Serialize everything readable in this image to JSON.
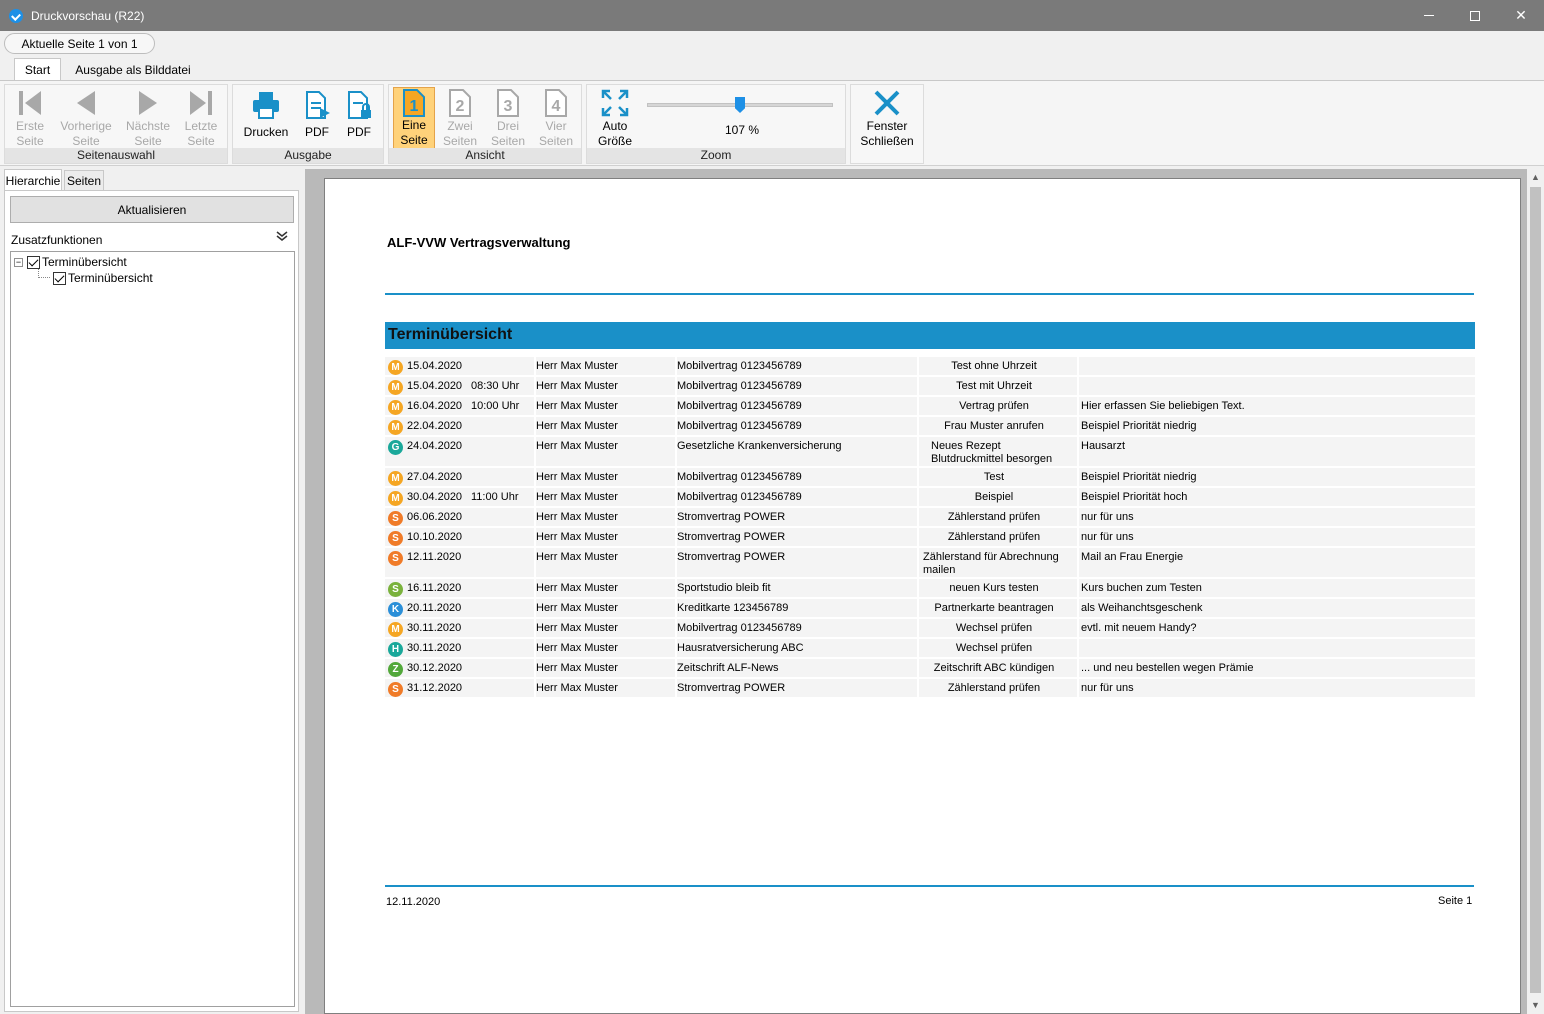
{
  "window": {
    "title": "Druckvorschau (R22)"
  },
  "pagebar": {
    "current_page": "Aktuelle Seite 1 von 1"
  },
  "ribbon_tabs": [
    "Start",
    "Ausgabe als Bilddatei"
  ],
  "ribbon": {
    "seitenauswahl": {
      "label": "Seitenauswahl",
      "first": [
        "Erste",
        "Seite"
      ],
      "prev": [
        "Vorherige",
        "Seite"
      ],
      "next": [
        "Nächste",
        "Seite"
      ],
      "last": [
        "Letzte",
        "Seite"
      ]
    },
    "ausgabe": {
      "label": "Ausgabe",
      "print": "Drucken",
      "pdf1": "PDF",
      "pdf2": "PDF"
    },
    "ansicht": {
      "label": "Ansicht",
      "one": [
        "Eine",
        "Seite"
      ],
      "two": [
        "Zwei",
        "Seiten"
      ],
      "three": [
        "Drei",
        "Seiten"
      ],
      "four": [
        "Vier",
        "Seiten"
      ]
    },
    "zoom": {
      "label": "Zoom",
      "auto": [
        "Auto",
        "Größe"
      ],
      "value": "107 %",
      "level": 0.5
    },
    "close": [
      "Fenster",
      "Schließen"
    ]
  },
  "left_panel": {
    "tabs": [
      "Hierarchie",
      "Seiten"
    ],
    "refresh": "Aktualisieren",
    "zusatz": "Zusatzfunktionen",
    "tree": [
      "Terminübersicht",
      "Terminübersicht"
    ]
  },
  "document": {
    "title": "ALF-VVW Vertragsverwaltung",
    "section": "Terminübersicht",
    "footer_date": "12.11.2020",
    "footer_page": "Seite 1",
    "rows": [
      {
        "badge": "M",
        "color": "#f5a623",
        "date": "15.04.2020",
        "time": "",
        "person": "Herr Max Muster",
        "contract": "Mobilvertrag 0123456789",
        "task": "Test ohne Uhrzeit",
        "note": ""
      },
      {
        "badge": "M",
        "color": "#f5a623",
        "date": "15.04.2020",
        "time": "08:30 Uhr",
        "person": "Herr Max Muster",
        "contract": "Mobilvertrag 0123456789",
        "task": "Test mit Uhrzeit",
        "note": ""
      },
      {
        "badge": "M",
        "color": "#f5a623",
        "date": "16.04.2020",
        "time": "10:00 Uhr",
        "person": "Herr Max Muster",
        "contract": "Mobilvertrag 0123456789",
        "task": "Vertrag prüfen",
        "note": "Hier erfassen Sie beliebigen Text."
      },
      {
        "badge": "M",
        "color": "#f5a623",
        "date": "22.04.2020",
        "time": "",
        "person": "Herr Max Muster",
        "contract": "Mobilvertrag 0123456789",
        "task": "Frau Muster anrufen",
        "note": "Beispiel Priorität niedrig"
      },
      {
        "badge": "G",
        "color": "#1aa89a",
        "date": "24.04.2020",
        "time": "",
        "person": "Herr Max Muster",
        "contract": "Gesetzliche Krankenversicherung",
        "task": "Neues Rezept Blutdruckmittel besorgen",
        "note": "Hausarzt",
        "tall": true
      },
      {
        "badge": "M",
        "color": "#f5a623",
        "date": "27.04.2020",
        "time": "",
        "person": "Herr Max Muster",
        "contract": "Mobilvertrag 0123456789",
        "task": "Test",
        "note": "Beispiel Priorität niedrig"
      },
      {
        "badge": "M",
        "color": "#f5a623",
        "date": "30.04.2020",
        "time": "11:00 Uhr",
        "person": "Herr Max Muster",
        "contract": "Mobilvertrag 0123456789",
        "task": "Beispiel",
        "note": "Beispiel Priorität hoch"
      },
      {
        "badge": "S",
        "color": "#f07b28",
        "date": "06.06.2020",
        "time": "",
        "person": "Herr Max Muster",
        "contract": "Stromvertrag POWER",
        "task": "Zählerstand prüfen",
        "note": "nur für uns"
      },
      {
        "badge": "S",
        "color": "#f07b28",
        "date": "10.10.2020",
        "time": "",
        "person": "Herr Max Muster",
        "contract": "Stromvertrag POWER",
        "task": "Zählerstand prüfen",
        "note": "nur für uns"
      },
      {
        "badge": "S",
        "color": "#f07b28",
        "date": "12.11.2020",
        "time": "",
        "person": "Herr Max Muster",
        "contract": "Stromvertrag POWER",
        "task": "Zählerstand für Abrechnung mailen",
        "note": "Mail an Frau Energie",
        "tall": true
      },
      {
        "badge": "S",
        "color": "#7ab23c",
        "date": "16.11.2020",
        "time": "",
        "person": "Herr Max Muster",
        "contract": "Sportstudio bleib fit",
        "task": "neuen Kurs testen",
        "note": "Kurs buchen zum Testen"
      },
      {
        "badge": "K",
        "color": "#2b8fd8",
        "date": "20.11.2020",
        "time": "",
        "person": "Herr Max Muster",
        "contract": "Kreditkarte 123456789",
        "task": "Partnerkarte beantragen",
        "note": "als Weihanchtsgeschenk"
      },
      {
        "badge": "M",
        "color": "#f5a623",
        "date": "30.11.2020",
        "time": "",
        "person": "Herr Max Muster",
        "contract": "Mobilvertrag 0123456789",
        "task": "Wechsel prüfen",
        "note": "evtl. mit neuem Handy?"
      },
      {
        "badge": "H",
        "color": "#1aa89a",
        "date": "30.11.2020",
        "time": "",
        "person": "Herr Max Muster",
        "contract": "Hausratversicherung ABC",
        "task": "Wechsel prüfen",
        "note": ""
      },
      {
        "badge": "Z",
        "color": "#52a83a",
        "date": "30.12.2020",
        "time": "",
        "person": "Herr Max Muster",
        "contract": "Zeitschrift ALF-News",
        "task": "Zeitschrift ABC kündigen",
        "note": "... und neu bestellen wegen Prämie"
      },
      {
        "badge": "S",
        "color": "#f07b28",
        "date": "31.12.2020",
        "time": "",
        "person": "Herr Max Muster",
        "contract": "Stromvertrag POWER",
        "task": "Zählerstand prüfen",
        "note": "nur für uns"
      }
    ]
  }
}
